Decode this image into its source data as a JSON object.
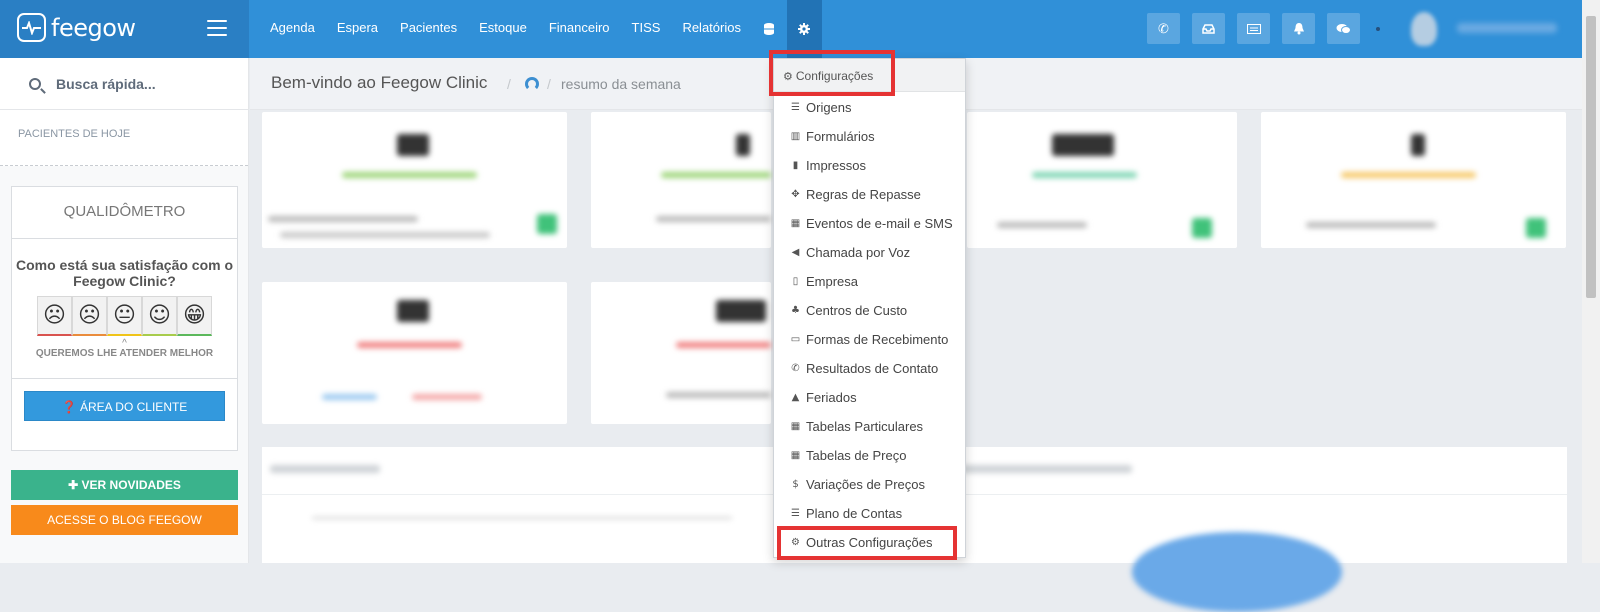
{
  "header": {
    "logo": "feegow",
    "nav": [
      "Agenda",
      "Espera",
      "Pacientes",
      "Estoque",
      "Financeiro",
      "TISS",
      "Relatórios"
    ],
    "icons": [
      "database-icon",
      "gear-icon"
    ],
    "toolbar_icons": [
      "phone-icon",
      "inbox-icon",
      "card-icon",
      "bell-icon",
      "chat-icon"
    ]
  },
  "sidebar": {
    "search_placeholder": "Busca rápida...",
    "today_label": "PACIENTES DE HOJE",
    "qual": {
      "title": "QUALIDÔMETRO",
      "question": "Como está sua satisfação com o Feegow Clinic?",
      "faces": [
        "☹",
        "☹",
        "😐",
        "☺",
        "😁"
      ],
      "face_colors": [
        "#d9534f",
        "#ea8c3c",
        "#f0c419",
        "#a8cc4c",
        "#5cb85c"
      ],
      "subtitle": "QUEREMOS LHE ATENDER MELHOR",
      "client_area_button": "ÁREA DO CLIENTE"
    },
    "news_button": "VER NOVIDADES",
    "blog_button": "ACESSE O BLOG FEEGOW"
  },
  "content": {
    "title": "Bem-vindo ao Feegow Clinic",
    "breadcrumb": "resumo da semana"
  },
  "config_menu": {
    "header": "Configurações",
    "items": [
      {
        "label": "Origens",
        "icon": "list-icon"
      },
      {
        "label": "Formulários",
        "icon": "bar-chart-icon"
      },
      {
        "label": "Impressos",
        "icon": "file-icon"
      },
      {
        "label": "Regras de Repasse",
        "icon": "puzzle-icon"
      },
      {
        "label": "Eventos de e-mail e SMS",
        "icon": "calendar-icon"
      },
      {
        "label": "Chamada por Voz",
        "icon": "speaker-icon"
      },
      {
        "label": "Empresa",
        "icon": "building-icon"
      },
      {
        "label": "Centros de Custo",
        "icon": "sitemap-icon"
      },
      {
        "label": "Formas de Recebimento",
        "icon": "credit-card-icon"
      },
      {
        "label": "Resultados de Contato",
        "icon": "phone-icon"
      },
      {
        "label": "Feriados",
        "icon": "road-icon"
      },
      {
        "label": "Tabelas Particulares",
        "icon": "table-icon"
      },
      {
        "label": "Tabelas de Preço",
        "icon": "table-icon"
      },
      {
        "label": "Variações de Preços",
        "icon": "dollar-icon"
      },
      {
        "label": "Plano de Contas",
        "icon": "list-alt-icon"
      },
      {
        "label": "Outras Configurações",
        "icon": "gears-icon"
      }
    ]
  },
  "colors": {
    "accent": "#3090d8",
    "highlight": "#e53333",
    "green": "#3ab38c",
    "orange": "#f88a1b"
  }
}
